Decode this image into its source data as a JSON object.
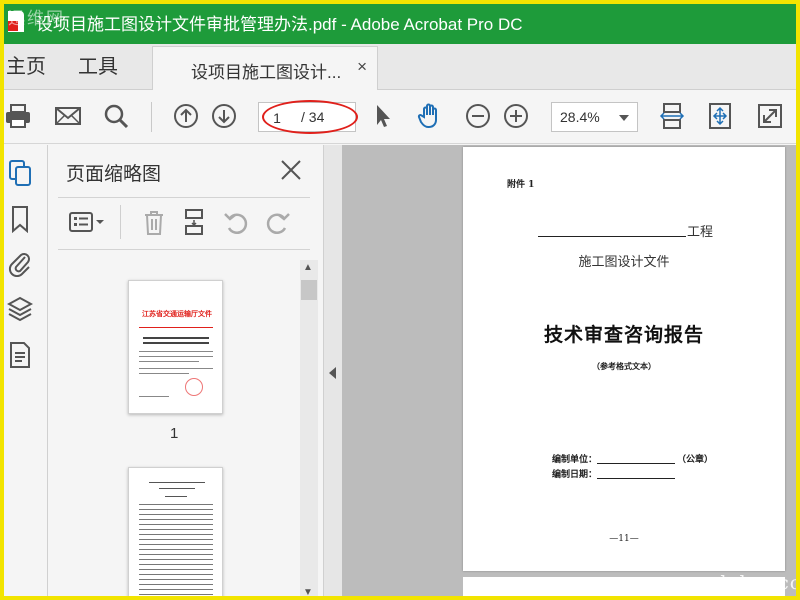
{
  "window": {
    "title": "设项目施工图设计文件审批管理办法.pdf - Adobe Acrobat Pro DC",
    "watermark_top": "迅维网"
  },
  "tabs": {
    "home": "主页",
    "tools": "工具",
    "document": "设项目施工图设计...",
    "close": "×"
  },
  "toolbar": {
    "current_page": "1",
    "total_pages": "/ 34",
    "zoom": "28.4%"
  },
  "panel": {
    "title": "页面缩略图",
    "thumbnails": [
      {
        "number": "1",
        "heading": "江苏省交通运输厅文件"
      },
      {
        "number": ""
      }
    ]
  },
  "page": {
    "annex": "附件 1",
    "project_suffix": "工程",
    "subtitle": "施工图设计文件",
    "main_title": "技术审查咨询报告",
    "note": "（参考格式文本）",
    "unit_label": "编制单位：",
    "unit_tail": "（公章）",
    "date_label": "编制日期：",
    "page_number": "—11—"
  },
  "watermark_bottom": "www.chdao.com",
  "colors": {
    "title_bar": "#1e9b3a",
    "accent": "#1f6fb5",
    "annotation_red": "#e0201b",
    "frame": "#f2e400"
  }
}
